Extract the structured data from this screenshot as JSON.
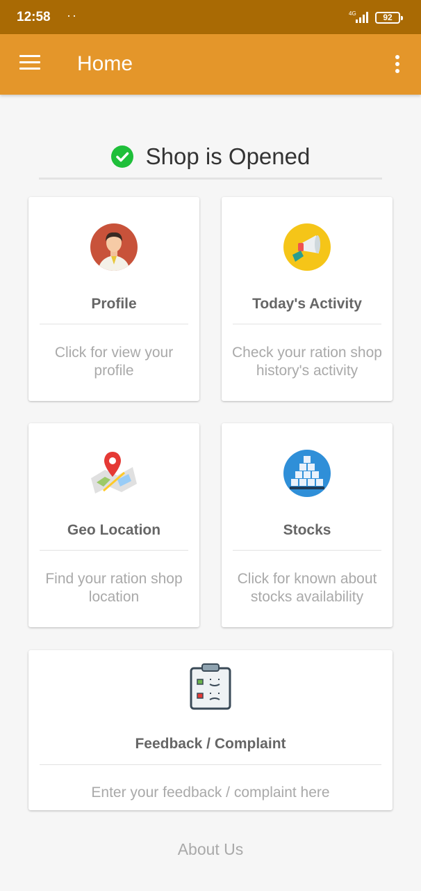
{
  "status_bar": {
    "time": "12:58",
    "dots": "··",
    "network": "4G",
    "battery": "92"
  },
  "app_bar": {
    "title": "Home",
    "menu_icon": "hamburger-menu-icon",
    "more_icon": "more-vert-icon"
  },
  "shop_status": {
    "text": "Shop is Opened",
    "icon": "check-circle-icon",
    "color": "#1fbf3a"
  },
  "cards": {
    "profile": {
      "title": "Profile",
      "description": "Click for view your profile",
      "icon": "person-avatar-icon"
    },
    "activity": {
      "title": "Today's Activity",
      "description": "Check your ration shop history's activity",
      "icon": "megaphone-icon"
    },
    "geo": {
      "title": "Geo Location",
      "description": "Find your ration shop location",
      "icon": "map-pin-icon"
    },
    "stocks": {
      "title": "Stocks",
      "description": "Click for known about stocks availability",
      "icon": "stacked-boxes-icon"
    },
    "feedback": {
      "title": "Feedback / Complaint",
      "description": "Enter your feedback / complaint here",
      "icon": "feedback-clipboard-icon"
    }
  },
  "footer": {
    "about_label": "About Us"
  },
  "colors": {
    "status_bar": "#a96a04",
    "app_bar": "#e4962a",
    "background": "#f6f6f6"
  }
}
